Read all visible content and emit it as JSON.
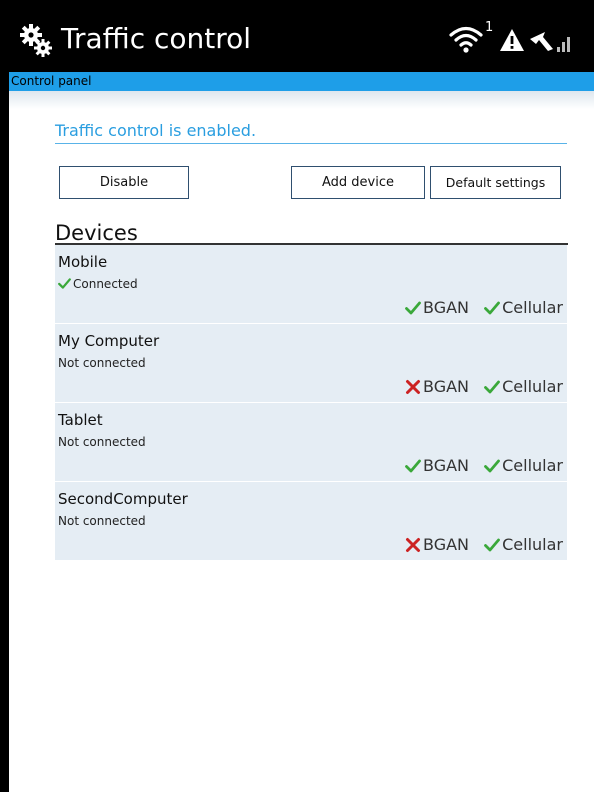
{
  "header": {
    "app_title": "Traffic control",
    "wifi_badge": "1",
    "breadcrumb": "Control panel"
  },
  "status": {
    "message": "Traffic control is enabled."
  },
  "toolbar": {
    "disable_label": "Disable",
    "add_device_label": "Add device",
    "default_settings_label": "Default settings"
  },
  "devices": {
    "heading": "Devices",
    "items": [
      {
        "name": "Mobile",
        "status": "Connected",
        "connected": true,
        "bgan": true,
        "bgan_label": "BGAN",
        "cellular": true,
        "cellular_label": "Cellular"
      },
      {
        "name": "My Computer",
        "status": "Not connected",
        "connected": false,
        "bgan": false,
        "bgan_label": "BGAN",
        "cellular": true,
        "cellular_label": "Cellular"
      },
      {
        "name": "Tablet",
        "status": "Not connected",
        "connected": false,
        "bgan": true,
        "bgan_label": "BGAN",
        "cellular": true,
        "cellular_label": "Cellular"
      },
      {
        "name": "SecondComputer",
        "status": "Not connected",
        "connected": false,
        "bgan": false,
        "bgan_label": "BGAN",
        "cellular": true,
        "cellular_label": "Cellular"
      }
    ]
  },
  "colors": {
    "accent": "#1e9ee8",
    "check": "#3aa83a",
    "cross": "#cc2222",
    "row_bg": "#e5edf4"
  },
  "icons": {
    "app": "gears-icon",
    "status": [
      "wifi-icon",
      "warning-icon",
      "signal-arrow-icon",
      "signal-bars-icon"
    ],
    "allowed": "check-icon",
    "blocked": "cross-icon"
  }
}
